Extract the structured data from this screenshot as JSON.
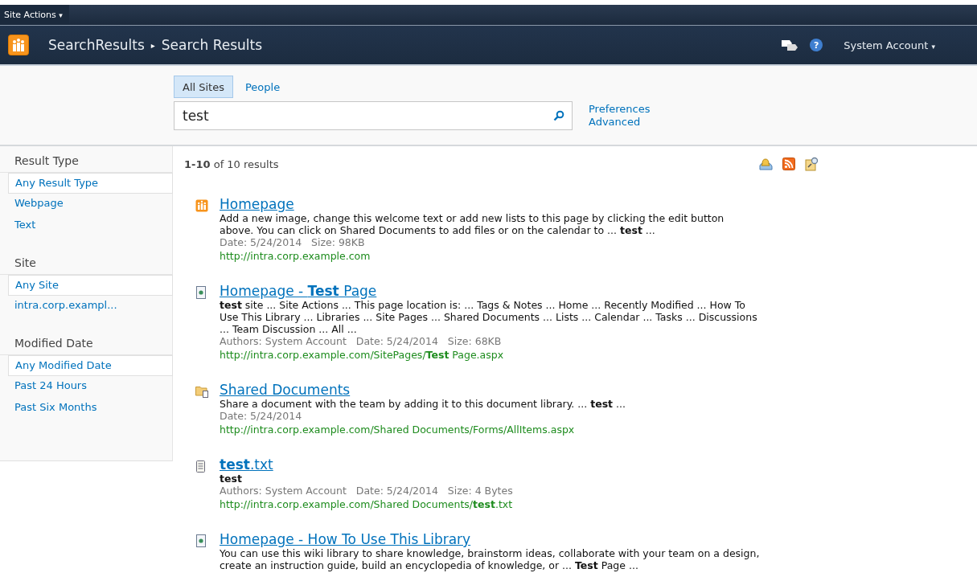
{
  "site_actions": {
    "label": "Site Actions",
    "caret": "▾"
  },
  "header": {
    "breadcrumb": [
      "SearchResults",
      "Search Results"
    ],
    "separator": "▸",
    "user": "System Account",
    "user_caret": "▾",
    "help": "?"
  },
  "scopes": [
    {
      "label": "All Sites",
      "selected": true
    },
    {
      "label": "People",
      "selected": false
    }
  ],
  "search": {
    "value": "test"
  },
  "search_links": [
    "Preferences",
    "Advanced"
  ],
  "result_count": "**1-10** of 10 results",
  "refiners": [
    {
      "heading": "Result Type",
      "items": [
        {
          "label": "Any Result Type",
          "selected": true
        },
        {
          "label": "Webpage",
          "selected": false
        },
        {
          "label": "Text",
          "selected": false
        }
      ]
    },
    {
      "heading": "Site",
      "items": [
        {
          "label": "Any Site",
          "selected": true
        },
        {
          "label": "intra.corp.exampl...",
          "selected": false
        }
      ]
    },
    {
      "heading": "Modified Date",
      "items": [
        {
          "label": "Any Modified Date",
          "selected": true
        },
        {
          "label": "Past 24 Hours",
          "selected": false
        },
        {
          "label": "Past Six Months",
          "selected": false
        }
      ]
    }
  ],
  "results": [
    {
      "kind": "site",
      "title": "Homepage",
      "description": "Add a new image, change this welcome text or add new lists to this page by clicking the edit button above. You can click on Shared Documents to add files or on the calendar to ... **test** ...",
      "meta": "Date: 5/24/2014   Size: 98KB",
      "url": "http://intra.corp.example.com"
    },
    {
      "kind": "page",
      "title": "Homepage - **Test** Page",
      "description": "**test** site ... Site Actions ... This page location is: ... Tags & Notes ... Home ... Recently Modified ... How To Use This Library ... Libraries ... Site Pages ... Shared Documents ... Lists ... Calendar ... Tasks ... Discussions ... Team Discussion ... All ...",
      "meta": "Authors: System Account   Date: 5/24/2014   Size: 68KB",
      "url": "http://intra.corp.example.com/SitePages/**Test** Page.aspx"
    },
    {
      "kind": "library",
      "title": "Shared Documents",
      "description": "Share a document with the team by adding it to this document library. ... **test** ...",
      "meta": "Date: 5/24/2014",
      "url": "http://intra.corp.example.com/Shared Documents/Forms/AllItems.aspx"
    },
    {
      "kind": "text",
      "title": "**test**.txt",
      "description": "**test**",
      "meta": "Authors: System Account   Date: 5/24/2014   Size: 4 Bytes",
      "url": "http://intra.corp.example.com/Shared Documents/**test**.txt"
    },
    {
      "kind": "page",
      "title": "Homepage - How To Use This Library",
      "description": "You can use this wiki library to share knowledge, brainstorm ideas, collaborate with your team on a design, create an instruction guide, build an encyclopedia of knowledge, or ... **Test** Page ..."
    }
  ]
}
